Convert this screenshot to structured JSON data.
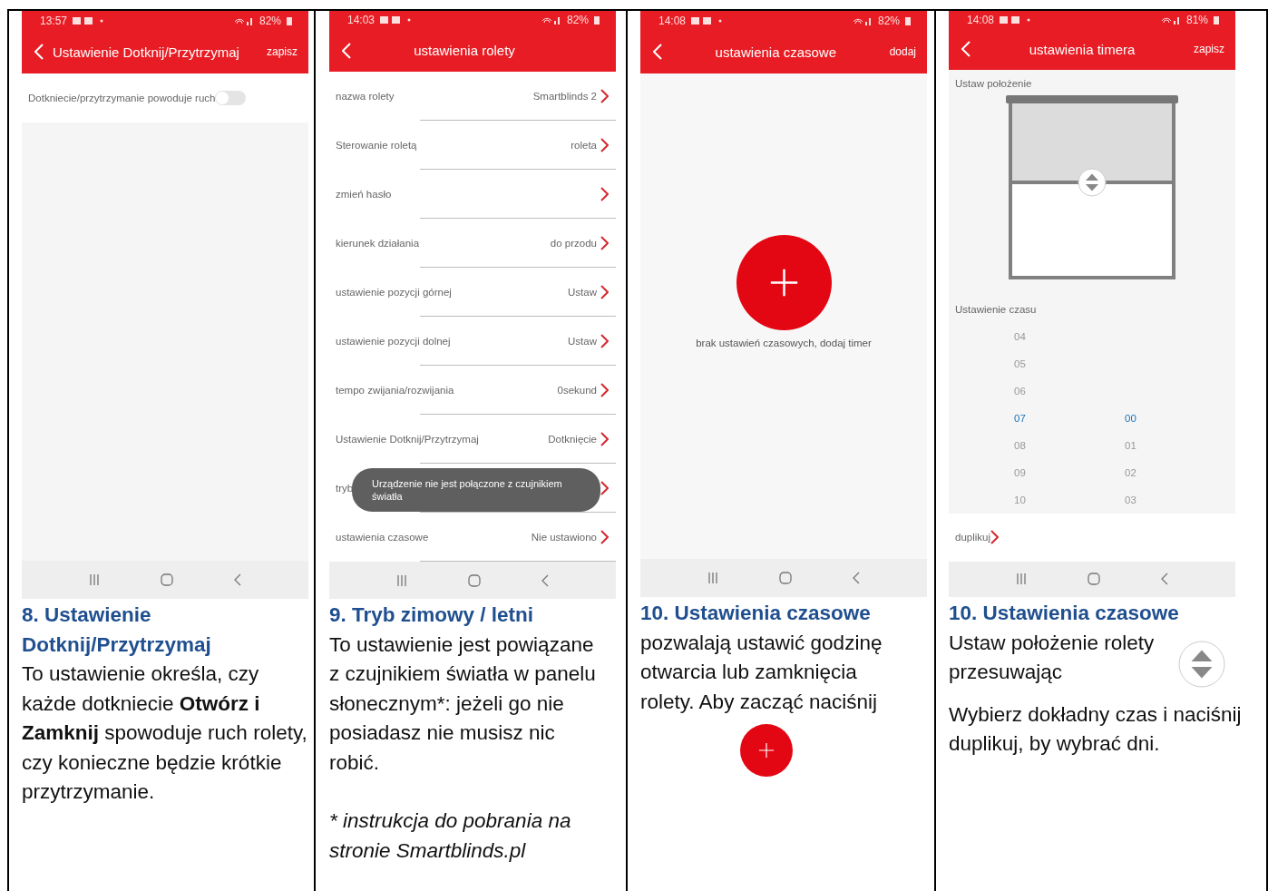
{
  "columns": [
    {
      "phone": {
        "kind": "toggle",
        "status": {
          "time": "13:57",
          "battery": "82%"
        },
        "header": {
          "title": "Ustawienie Dotknij/Przytrzymaj",
          "action": "zapisz"
        },
        "rows": [
          {
            "label": "Dotkniecie/przytrzymanie powoduje ruch",
            "on": false
          }
        ]
      },
      "caption": {
        "title": "8. Ustawienie Dotknij/Przytrzymaj",
        "paragraphs": [
          {
            "text": "To ustawienie określa, czy każde dotkniecie **Otwórz i Zamknij** spowoduje ruch rolety, czy konieczne będzie krótkie przytrzymanie."
          }
        ]
      }
    },
    {
      "phone": {
        "kind": "list",
        "status": {
          "time": "14:03",
          "battery": "82%"
        },
        "header": {
          "title": "ustawienia rolety"
        },
        "rows": [
          {
            "label": "nazwa rolety",
            "value": "Smartblinds 2"
          },
          {
            "label": "Sterowanie roletą",
            "value": "roleta"
          },
          {
            "label": "zmień hasło"
          },
          {
            "label": "kierunek działania",
            "value": "do przodu"
          },
          {
            "label": "ustawienie pozycji górnej",
            "value": "Ustaw"
          },
          {
            "label": "ustawienie pozycji dolnej",
            "value": "Ustaw"
          },
          {
            "label": "tempo zwijania/rozwijania",
            "value": "0sekund"
          },
          {
            "label": "Ustawienie Dotknij/Przytrzymaj",
            "value": "Dotknięcie"
          },
          {
            "label": "tryb"
          },
          {
            "label": "ustawienia czasowe",
            "value": "Nie ustawiono"
          }
        ],
        "toast": "Urządzenie nie jest połączone z czujnikiem światła"
      },
      "caption": {
        "title": "9. Tryb zimowy / letni",
        "paragraphs": [
          {
            "text": "To ustawienie jest powiązane z czujnikiem światła w panelu słonecznym*: jeżeli go nie posiadasz nie musisz nic robić."
          }
        ],
        "footnote": "*  instrukcja do pobrania na stronie Smartblinds.pl"
      }
    },
    {
      "phone": {
        "kind": "empty",
        "status": {
          "time": "14:08",
          "battery": "82%"
        },
        "header": {
          "title": "ustawienia czasowe",
          "action": "dodaj"
        },
        "message": "brak ustawień czasowych, dodaj timer"
      },
      "caption": {
        "title": "10. Ustawienia czasowe",
        "paragraphs": [
          {
            "text": "pozwalają ustawić godzinę otwarcia lub zamknięcia rolety. Aby zacząć naciśnij"
          }
        ]
      }
    },
    {
      "phone": {
        "kind": "timer",
        "status": {
          "time": "14:08",
          "battery": "81%"
        },
        "header": {
          "title": "ustawienia timera",
          "action": "zapisz"
        },
        "position_label": "Ustaw położenie",
        "level": 0.45,
        "time_label": "Ustawienie czasu",
        "hours": [
          {
            "value": "04",
            "selected": false
          },
          {
            "value": "05",
            "selected": false
          },
          {
            "value": "06",
            "selected": false
          },
          {
            "value": "07",
            "selected": true
          },
          {
            "value": "08",
            "selected": false
          },
          {
            "value": "09",
            "selected": false
          },
          {
            "value": "10",
            "selected": false
          }
        ],
        "minutes": [
          {
            "value": "00",
            "selected": true
          },
          {
            "value": "01",
            "selected": false
          },
          {
            "value": "02",
            "selected": false
          },
          {
            "value": "03",
            "selected": false
          }
        ],
        "duplicate": "duplikuj"
      },
      "caption": {
        "title": "10. Ustawienia czasowe",
        "paragraphs": [
          {
            "text": "Ustaw położenie rolety przesuwając"
          },
          {
            "text": "Wybierz dokładny czas i naciśnij duplikuj, by wybrać dni."
          }
        ]
      }
    }
  ]
}
